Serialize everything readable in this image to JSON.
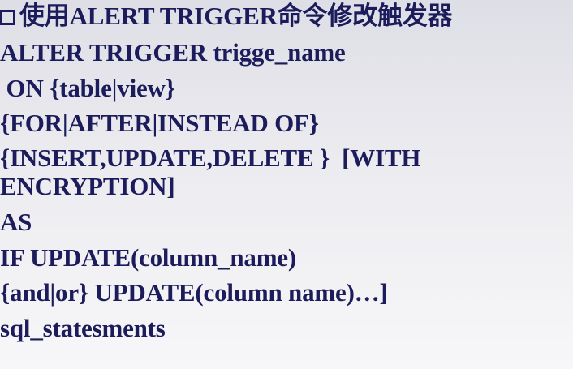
{
  "slide": {
    "heading": "使用ALERT TRIGGER命令修改触发器",
    "lines": [
      "ALTER TRIGGER trigge_name",
      " ON {table|view}",
      "{FOR|AFTER|INSTEAD OF}",
      "{INSERT,UPDATE,DELETE }  [WITH",
      "ENCRYPTION]",
      "AS",
      "IF UPDATE(column_name)",
      "{and|or} UPDATE(column name)…]",
      "sql_statesments"
    ]
  }
}
